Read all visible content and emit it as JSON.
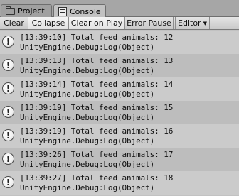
{
  "tabs": {
    "project": "Project",
    "console": "Console"
  },
  "toolbar": {
    "clear": "Clear",
    "collapse": "Collapse",
    "clear_on_play": "Clear on Play",
    "error_pause": "Error Pause",
    "editor": "Editor"
  },
  "log": {
    "entries": [
      {
        "line1": "[13:39:10] Total feed animals: 12",
        "line2": "UnityEngine.Debug:Log(Object)"
      },
      {
        "line1": "[13:39:13] Total feed animals: 13",
        "line2": "UnityEngine.Debug:Log(Object)"
      },
      {
        "line1": "[13:39:14] Total feed animals: 14",
        "line2": "UnityEngine.Debug:Log(Object)"
      },
      {
        "line1": "[13:39:19] Total feed animals: 15",
        "line2": "UnityEngine.Debug:Log(Object)"
      },
      {
        "line1": "[13:39:19] Total feed animals: 16",
        "line2": "UnityEngine.Debug:Log(Object)"
      },
      {
        "line1": "[13:39:26] Total feed animals: 17",
        "line2": "UnityEngine.Debug:Log(Object)"
      },
      {
        "line1": "[13:39:27] Total feed animals: 18",
        "line2": "UnityEngine.Debug:Log(Object)"
      }
    ]
  }
}
